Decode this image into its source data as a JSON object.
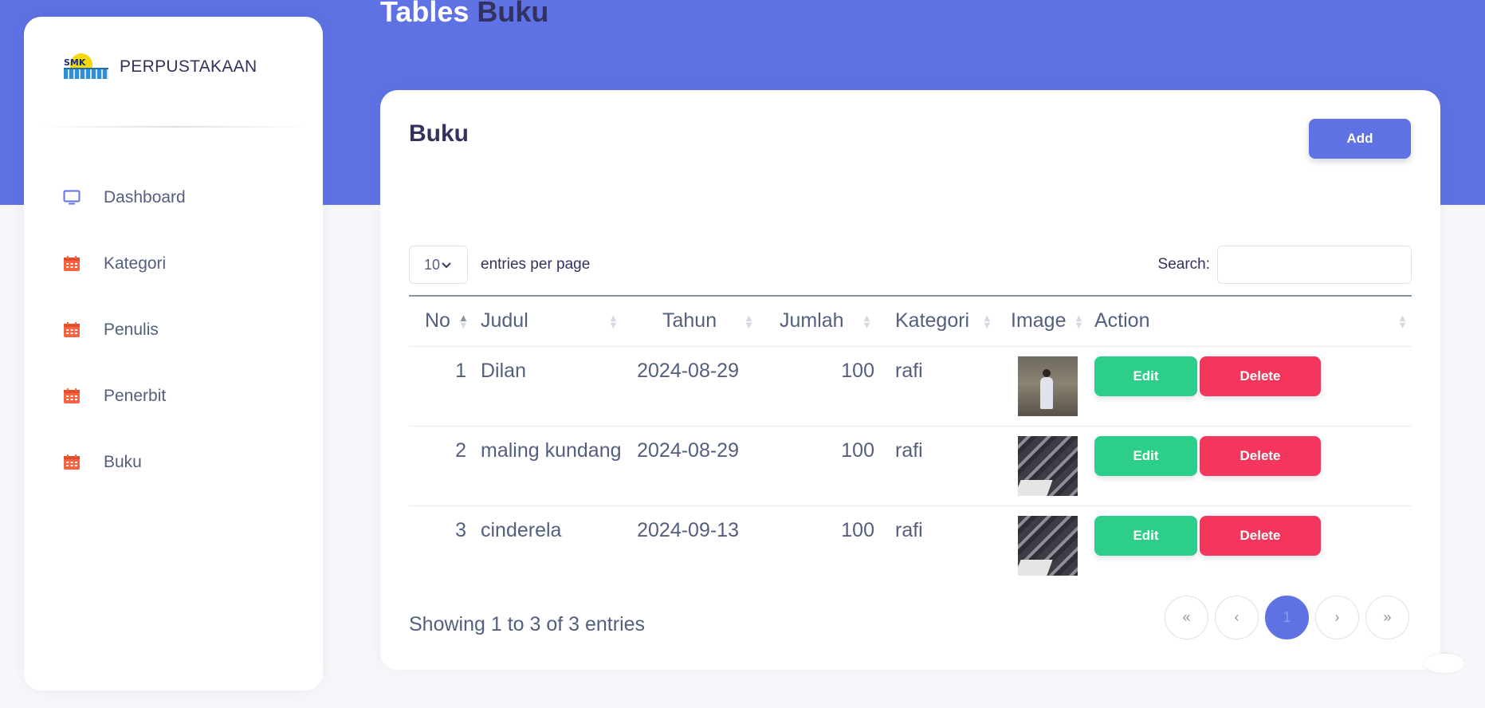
{
  "brand": {
    "logo_text": "SMK",
    "name": "PERPUSTAKAAN"
  },
  "sidebar": {
    "items": [
      {
        "label": "Dashboard",
        "icon": "monitor-icon",
        "color": "#5e72e4"
      },
      {
        "label": "Kategori",
        "icon": "calendar-icon",
        "color": "#fb6340"
      },
      {
        "label": "Penulis",
        "icon": "calendar-icon",
        "color": "#fb6340"
      },
      {
        "label": "Penerbit",
        "icon": "calendar-icon",
        "color": "#fb6340"
      },
      {
        "label": "Buku",
        "icon": "calendar-icon",
        "color": "#fb6340"
      }
    ]
  },
  "page": {
    "title_a": "Tables",
    "title_b": "Buku"
  },
  "card": {
    "title": "Buku",
    "add_label": "Add"
  },
  "table_controls": {
    "per_page_value": "10",
    "per_page_text": "entries per page",
    "search_label": "Search:",
    "search_value": ""
  },
  "table": {
    "columns": [
      "No",
      "Judul",
      "Tahun",
      "Jumlah",
      "Kategori",
      "Image",
      "Action"
    ],
    "rows": [
      {
        "no": "1",
        "judul": "Dilan",
        "tahun": "2024-08-29",
        "jumlah": "100",
        "kategori": "rafi",
        "image": "photo-person-walking"
      },
      {
        "no": "2",
        "judul": "maling kundang",
        "tahun": "2024-08-29",
        "jumlah": "100",
        "kategori": "rafi",
        "image": "photo-classroom-desks"
      },
      {
        "no": "3",
        "judul": "cinderela",
        "tahun": "2024-09-13",
        "jumlah": "100",
        "kategori": "rafi",
        "image": "photo-classroom-desks"
      }
    ],
    "edit_label": "Edit",
    "delete_label": "Delete"
  },
  "footer": {
    "showing": "Showing 1 to 3 of 3 entries",
    "pager": [
      "«",
      "‹",
      "1",
      "›",
      "»"
    ],
    "current_page": "1"
  },
  "colors": {
    "primary": "#5e72e4",
    "success": "#2dce89",
    "danger": "#f5365c",
    "warning": "#fb6340"
  }
}
